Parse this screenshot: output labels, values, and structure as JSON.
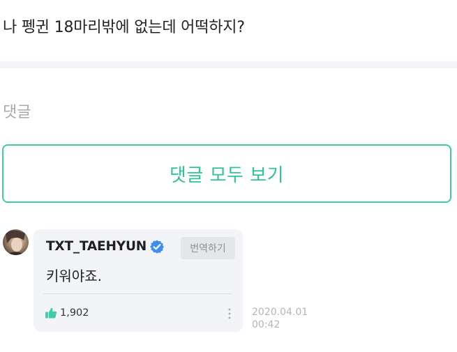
{
  "post": {
    "text": "나 펭귄 18마리밖에 없는데 어떡하지?"
  },
  "comments_section": {
    "title": "댓글",
    "view_all_label": "댓글 모두 보기"
  },
  "comment": {
    "author": "TXT_TAEHYUN",
    "verified": true,
    "translate_label": "번역하기",
    "body": "키워야죠.",
    "like_count": "1,902",
    "date": "2020.04.01",
    "time": "00:42"
  },
  "colors": {
    "accent": "#3fcca5",
    "verified": "#3d8ef0",
    "like": "#3fcca5"
  },
  "icons": {
    "verified": "verified-badge-icon",
    "like": "thumbs-up-icon",
    "more": "more-vertical-icon"
  }
}
